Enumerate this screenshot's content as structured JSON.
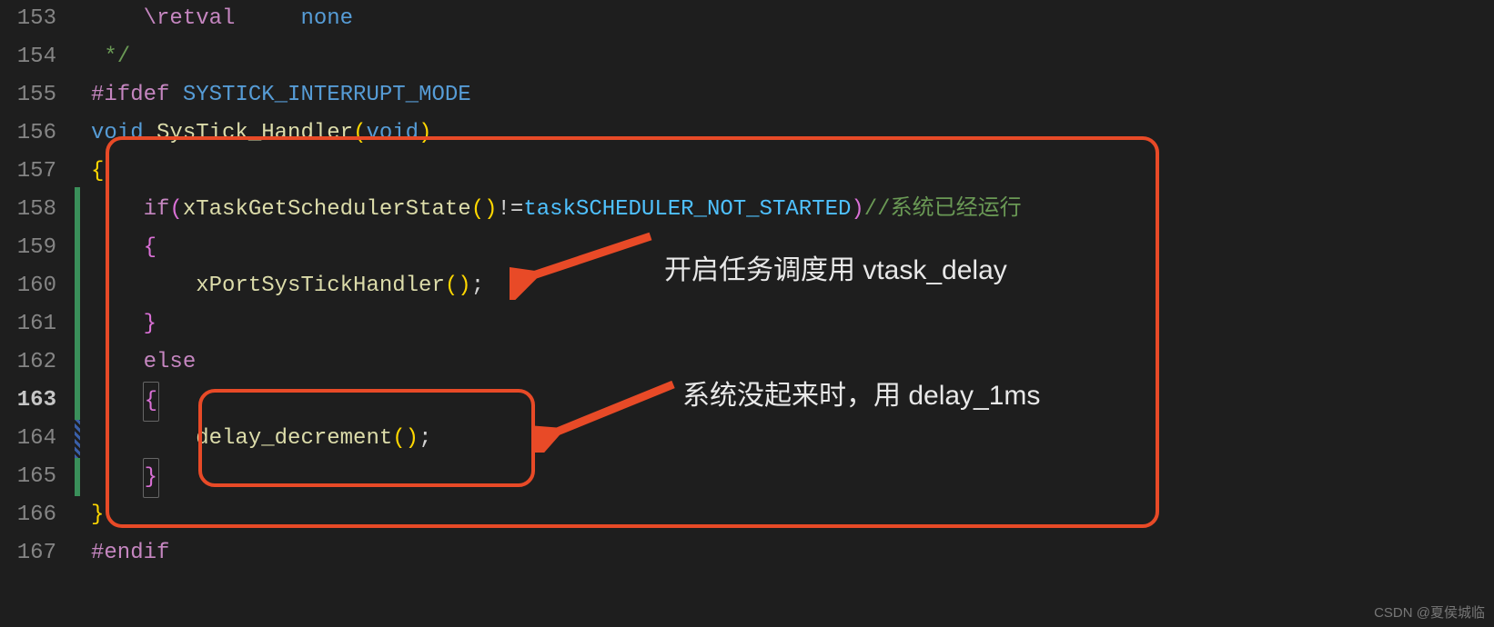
{
  "editor": {
    "lineNumbers": [
      "153",
      "154",
      "155",
      "156",
      "157",
      "158",
      "159",
      "160",
      "161",
      "162",
      "163",
      "164",
      "165",
      "166",
      "167"
    ],
    "currentLine": "163",
    "lines": {
      "l153": {
        "indent": "    ",
        "retval": "\\retval",
        "spaces": "     ",
        "none": "none"
      },
      "l154": {
        "text": " */"
      },
      "l155": {
        "hash": "#ifdef",
        "sp": " ",
        "macro": "SYSTICK_INTERRUPT_MODE"
      },
      "l156": {
        "kw": "void",
        "sp": " ",
        "fn": "SysTick_Handler",
        "lp": "(",
        "arg": "void",
        "rp": ")"
      },
      "l157": {
        "brace": "{"
      },
      "l158": {
        "indent": "    ",
        "kw": "if",
        "lp": "(",
        "fn": "xTaskGetSchedulerState",
        "lp2": "(",
        "rp2": ")",
        "op": "!=",
        "const": "taskSCHEDULER_NOT_STARTED",
        "rp": ")",
        "comment": "//系统已经运行"
      },
      "l159": {
        "indent": "    ",
        "brace": "{"
      },
      "l160": {
        "indent": "        ",
        "fn": "xPortSysTickHandler",
        "lp": "(",
        "rp": ")",
        "semi": ";"
      },
      "l161": {
        "indent": "    ",
        "brace": "}"
      },
      "l162": {
        "indent": "    ",
        "kw": "else"
      },
      "l163": {
        "indent": "    ",
        "brace": "{"
      },
      "l164": {
        "indent": "        ",
        "fn": "delay_decrement",
        "lp": "(",
        "rp": ")",
        "semi": ";"
      },
      "l165": {
        "indent": "    ",
        "brace": "}"
      },
      "l166": {
        "brace": "}"
      },
      "l167": {
        "hash": "#endif"
      }
    }
  },
  "annotations": {
    "text1": "开启任务调度用 vtask_delay",
    "text2": "系统没起来时，用 delay_1ms"
  },
  "watermark": "CSDN @夏侯城临"
}
